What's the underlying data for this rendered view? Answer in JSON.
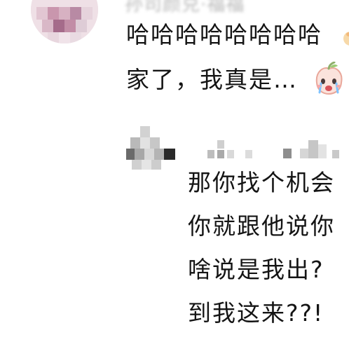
{
  "comment": {
    "username": "孙司颜兑·福福",
    "lines": [
      "哈哈哈哈哈哈哈哈",
      "家了，我真是…"
    ],
    "emoji": "crying-peach-emoji"
  },
  "reply": {
    "lines": [
      "那你找个机会",
      "你就跟他说你",
      "啥说是我出?",
      "到我这来??!"
    ]
  },
  "colors": {
    "text": "#141414",
    "username": "#b8b8b8",
    "background": "#ffffff"
  }
}
